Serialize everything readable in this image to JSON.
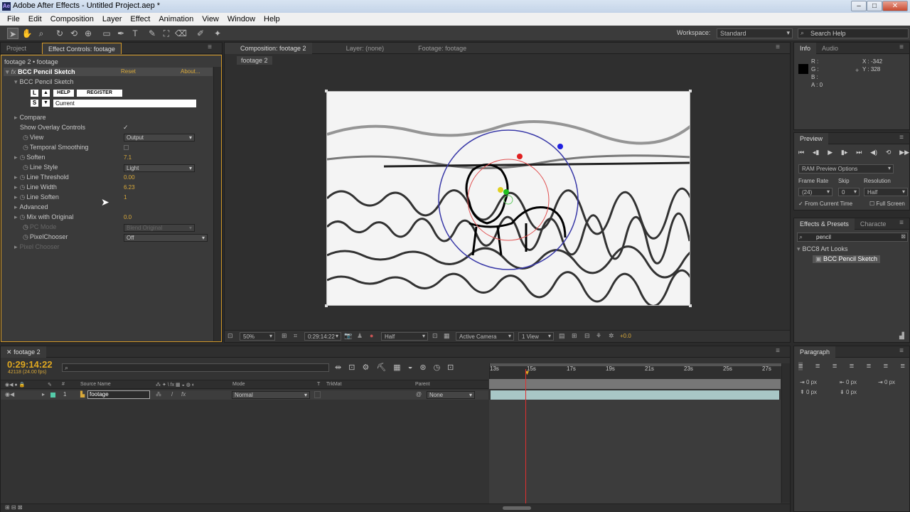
{
  "window": {
    "title": "Adobe After Effects - Untitled Project.aep *",
    "min": "–",
    "max": "□",
    "close": "✕"
  },
  "menu": [
    "File",
    "Edit",
    "Composition",
    "Layer",
    "Effect",
    "Animation",
    "View",
    "Window",
    "Help"
  ],
  "toolbar": {
    "workspace_label": "Workspace:",
    "workspace_value": "Standard",
    "search_placeholder": "Search Help"
  },
  "project_panel": {
    "tabs": [
      "Project",
      "Effect Controls: footage"
    ],
    "breadcrumb": "footage 2 • footage",
    "effect_name": "BCC Pencil Sketch",
    "reset": "Reset",
    "about": "About...",
    "group": "BCC Pencil Sketch",
    "help_btn": "HELP",
    "register_btn": "REGISTER",
    "key_L": "L",
    "key_S": "S",
    "preset_value": "Current",
    "rows": {
      "compare": "Compare",
      "overlay": "Show Overlay Controls",
      "view": "View",
      "view_val": "Output",
      "temporal": "Temporal Smoothing",
      "soften": "Soften",
      "soften_val": "7.1",
      "linestyle": "Line Style",
      "linestyle_val": "Light",
      "threshold": "Line Threshold",
      "threshold_val": "0.00",
      "width": "Line Width",
      "width_val": "6.23",
      "lsoften": "Line Soften",
      "lsoften_val": "1",
      "advanced": "Advanced",
      "mix": "Mix with Original",
      "mix_val": "0.0",
      "pcmode": "PC Mode",
      "pcmode_val": "Blend Original",
      "pixelchooser": "PixelChooser",
      "pixelchooser_val": "Off",
      "pixelchooser2": "Pixel Chooser"
    }
  },
  "comp_panel": {
    "tabs": [
      "Composition: footage 2",
      "Layer: (none)",
      "Footage: footage"
    ],
    "subtab": "footage 2",
    "zoom": "50%",
    "timecode": "0:29:14:22",
    "resolution": "Half",
    "camera": "Active Camera",
    "views": "1 View",
    "exposure": "+0.0"
  },
  "info_panel": {
    "tabs": [
      "Info",
      "Audio"
    ],
    "r": "R :",
    "g": "G :",
    "b": "B :",
    "a": "A : 0",
    "x": "X : -342",
    "y": "Y : 328"
  },
  "preview_panel": {
    "title": "Preview",
    "ram": "RAM Preview Options",
    "frame_rate_label": "Frame Rate",
    "skip_label": "Skip",
    "resolution_label": "Resolution",
    "frame_rate": "(24)",
    "skip": "0",
    "resolution": "Half",
    "from_current": "From Current Time",
    "full_screen": "Full Screen"
  },
  "effects_panel": {
    "tabs": [
      "Effects & Presets",
      "Characte"
    ],
    "search": "pencil",
    "category": "BCC8 Art Looks",
    "item": "BCC Pencil Sketch"
  },
  "timeline": {
    "tab": "footage 2",
    "timecode": "0:29:14:22",
    "fps": "42118 (24.00 fps)",
    "cols": {
      "source": "Source Name",
      "parent": "Parent",
      "mode": "Mode",
      "t": "T",
      "trkmat": "TrkMat",
      "num": "#"
    },
    "layer": {
      "num": "1",
      "name": "footage",
      "mode": "Normal",
      "parent": "None"
    },
    "ticks": [
      "13s",
      "15s",
      "17s",
      "19s",
      "21s",
      "23s",
      "25s",
      "27s"
    ]
  },
  "paragraph_panel": {
    "title": "Paragraph",
    "px": [
      "0 px",
      "0 px",
      "0 px",
      "0 px",
      "0 px"
    ]
  }
}
